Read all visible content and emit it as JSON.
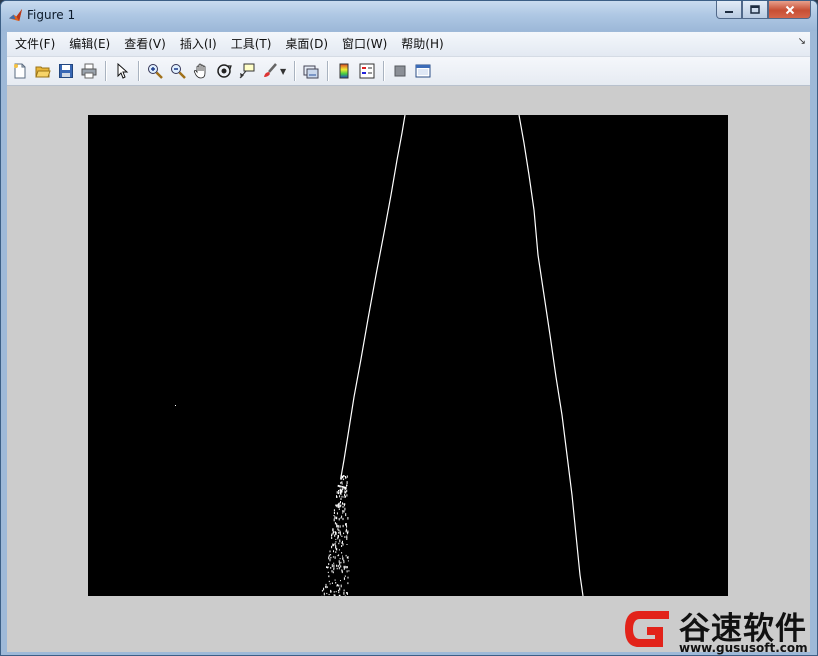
{
  "window": {
    "title": "Figure 1",
    "app_icon": "matlab-icon",
    "caption_buttons": {
      "minimize": "minimize-icon",
      "maximize": "maximize-icon",
      "close": "close-icon"
    }
  },
  "menubar": {
    "items": [
      {
        "label": "文件(F)"
      },
      {
        "label": "编辑(E)"
      },
      {
        "label": "查看(V)"
      },
      {
        "label": "插入(I)"
      },
      {
        "label": "工具(T)"
      },
      {
        "label": "桌面(D)"
      },
      {
        "label": "窗口(W)"
      },
      {
        "label": "帮助(H)"
      }
    ],
    "overflow_icon": "chevron-double-icon"
  },
  "toolbar": {
    "buttons": [
      "new-figure-icon",
      "open-file-icon",
      "save-icon",
      "print-icon",
      "edit-plot-arrow-icon",
      "zoom-in-icon",
      "zoom-out-icon",
      "pan-hand-icon",
      "rotate-3d-icon",
      "data-cursor-icon",
      "brush-icon",
      "link-plot-icon",
      "colorbar-icon",
      "legend-icon",
      "hide-plot-tools-icon",
      "show-plot-tools-icon"
    ]
  },
  "colors": {
    "figure_background": "#cccccc",
    "axes_background": "#000000",
    "edge_color": "#ffffff",
    "watermark_red": "#e2231a"
  },
  "watermark": {
    "name": "谷速软件",
    "url": "www.gususoft.com"
  }
}
